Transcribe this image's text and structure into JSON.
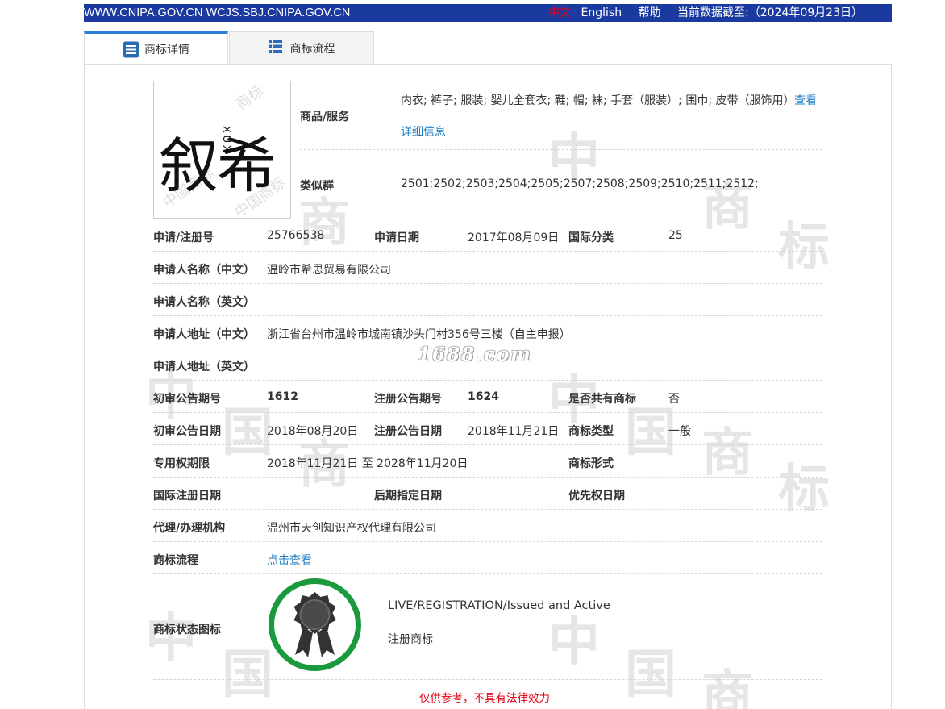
{
  "topbar": {
    "sites": "WWW.CNIPA.GOV.CN WCJS.SBJ.CNIPA.GOV.CN",
    "lang_cn": "中文",
    "lang_en": "English",
    "help": "帮助",
    "data_date": "当前数据截至:（2024年09月23日）"
  },
  "tabs": [
    {
      "label": "商标详情",
      "icon": "document-list-icon",
      "active": true
    },
    {
      "label": "商标流程",
      "icon": "list-icon",
      "active": false
    }
  ],
  "watermark": {
    "text": "1688.com"
  },
  "logo": {
    "chars": "叙希",
    "pinyin": "XUXI"
  },
  "detail": {
    "goods_label": "商品/服务",
    "goods_value": "内衣; 裤子; 服装; 婴儿全套衣; 鞋; 帽; 袜; 手套（服装）; 围巾; 皮带（服饰用）",
    "goods_more_1": "查看",
    "goods_more_2": "详细信息",
    "similar_label": "类似群",
    "similar_value": "2501;2502;2503;2504;2505;2507;2508;2509;2510;2511;2512;",
    "reg_no_label": "申请/注册号",
    "reg_no": "25766538",
    "app_date_label": "申请日期",
    "app_date": "2017年08月09日",
    "intl_class_label": "国际分类",
    "intl_class": "25",
    "applicant_cn_label": "申请人名称（中文）",
    "applicant_cn": "温岭市希思贸易有限公司",
    "applicant_en_label": "申请人名称（英文）",
    "address_cn_label": "申请人地址（中文）",
    "address_cn": "浙江省台州市温岭市城南镇沙头门村356号三楼（自主申报）",
    "address_en_label": "申请人地址（英文）",
    "prelim_no_label": "初审公告期号",
    "prelim_no": "1612",
    "reg_pub_no_label": "注册公告期号",
    "reg_pub_no": "1624",
    "shared_label": "是否共有商标",
    "shared": "否",
    "prelim_date_label": "初审公告日期",
    "prelim_date": "2018年08月20日",
    "reg_pub_date_label": "注册公告日期",
    "reg_pub_date": "2018年11月21日",
    "tm_type_label": "商标类型",
    "tm_type": "一般",
    "exclusive_label": "专用权期限",
    "exclusive": "2018年11月21日 至 2028年11月20日",
    "tm_form_label": "商标形式",
    "intl_reg_date_label": "国际注册日期",
    "later_date_label": "后期指定日期",
    "priority_date_label": "优先权日期",
    "agent_label": "代理/办理机构",
    "agent": "温州市天创知识产权代理有限公司",
    "flow_label": "商标流程",
    "flow_link": "点击查看",
    "status_label": "商标状态图标",
    "status_en": "LIVE/REGISTRATION/Issued and Active",
    "status_cn": "注册商标"
  },
  "disclaimer": "仅供参考，不具有法律效力",
  "colors": {
    "topbar": "#1a3aa0",
    "link": "#1f7fc4",
    "badge_ring": "#1a9a3c",
    "alert": "#e60012"
  }
}
